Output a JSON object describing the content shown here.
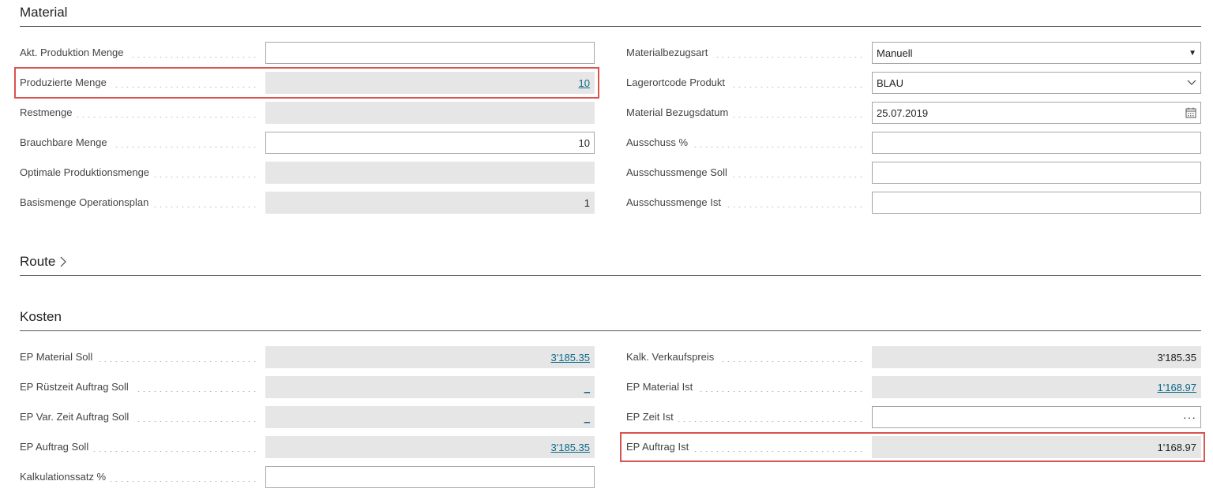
{
  "material": {
    "title": "Material",
    "left": [
      {
        "label": "Akt. Produktion Menge",
        "value": "",
        "kind": "input"
      },
      {
        "label": "Produzierte Menge",
        "value": "10",
        "kind": "ro-link"
      },
      {
        "label": "Restmenge",
        "value": "",
        "kind": "ro"
      },
      {
        "label": "Brauchbare Menge",
        "value": "10",
        "kind": "input"
      },
      {
        "label": "Optimale Produktionsmenge",
        "value": "",
        "kind": "ro"
      },
      {
        "label": "Basismenge Operationsplan",
        "value": "1",
        "kind": "ro"
      }
    ],
    "right": [
      {
        "label": "Materialbezugsart",
        "value": "Manuell",
        "kind": "select"
      },
      {
        "label": "Lagerortcode Produkt",
        "value": "BLAU",
        "kind": "dropdown"
      },
      {
        "label": "Material Bezugsdatum",
        "value": "25.07.2019",
        "kind": "date"
      },
      {
        "label": "Ausschuss %",
        "value": "",
        "kind": "input"
      },
      {
        "label": "Ausschussmenge Soll",
        "value": "",
        "kind": "input"
      },
      {
        "label": "Ausschussmenge Ist",
        "value": "",
        "kind": "input"
      }
    ]
  },
  "route": {
    "title": "Route"
  },
  "kosten": {
    "title": "Kosten",
    "left": [
      {
        "label": "EP Material Soll",
        "value": "3'185.35",
        "kind": "ro-link"
      },
      {
        "label": "EP Rüstzeit Auftrag Soll",
        "value": "_",
        "kind": "ro-link"
      },
      {
        "label": "EP Var. Zeit Auftrag Soll",
        "value": "_",
        "kind": "ro-link"
      },
      {
        "label": "EP Auftrag Soll",
        "value": "3'185.35",
        "kind": "ro-link"
      },
      {
        "label": "Kalkulationssatz %",
        "value": "",
        "kind": "input"
      }
    ],
    "right": [
      {
        "label": "Kalk. Verkaufspreis",
        "value": "3'185.35",
        "kind": "ro"
      },
      {
        "label": "EP Material Ist",
        "value": "1'168.97",
        "kind": "ro-link"
      },
      {
        "label": "EP Zeit Ist",
        "value": "···",
        "kind": "input"
      },
      {
        "label": "EP Auftrag Ist",
        "value": "1'168.97",
        "kind": "ro"
      }
    ]
  },
  "colors": {
    "highlight": "#d9534f",
    "link": "#0b6a8a",
    "readonly_bg": "#e6e6e6"
  },
  "icons": {
    "route_chevron": "chevron-right-icon",
    "calendar": "calendar-icon",
    "dropdown": "chevron-down-icon",
    "select": "triangle-down-icon"
  }
}
